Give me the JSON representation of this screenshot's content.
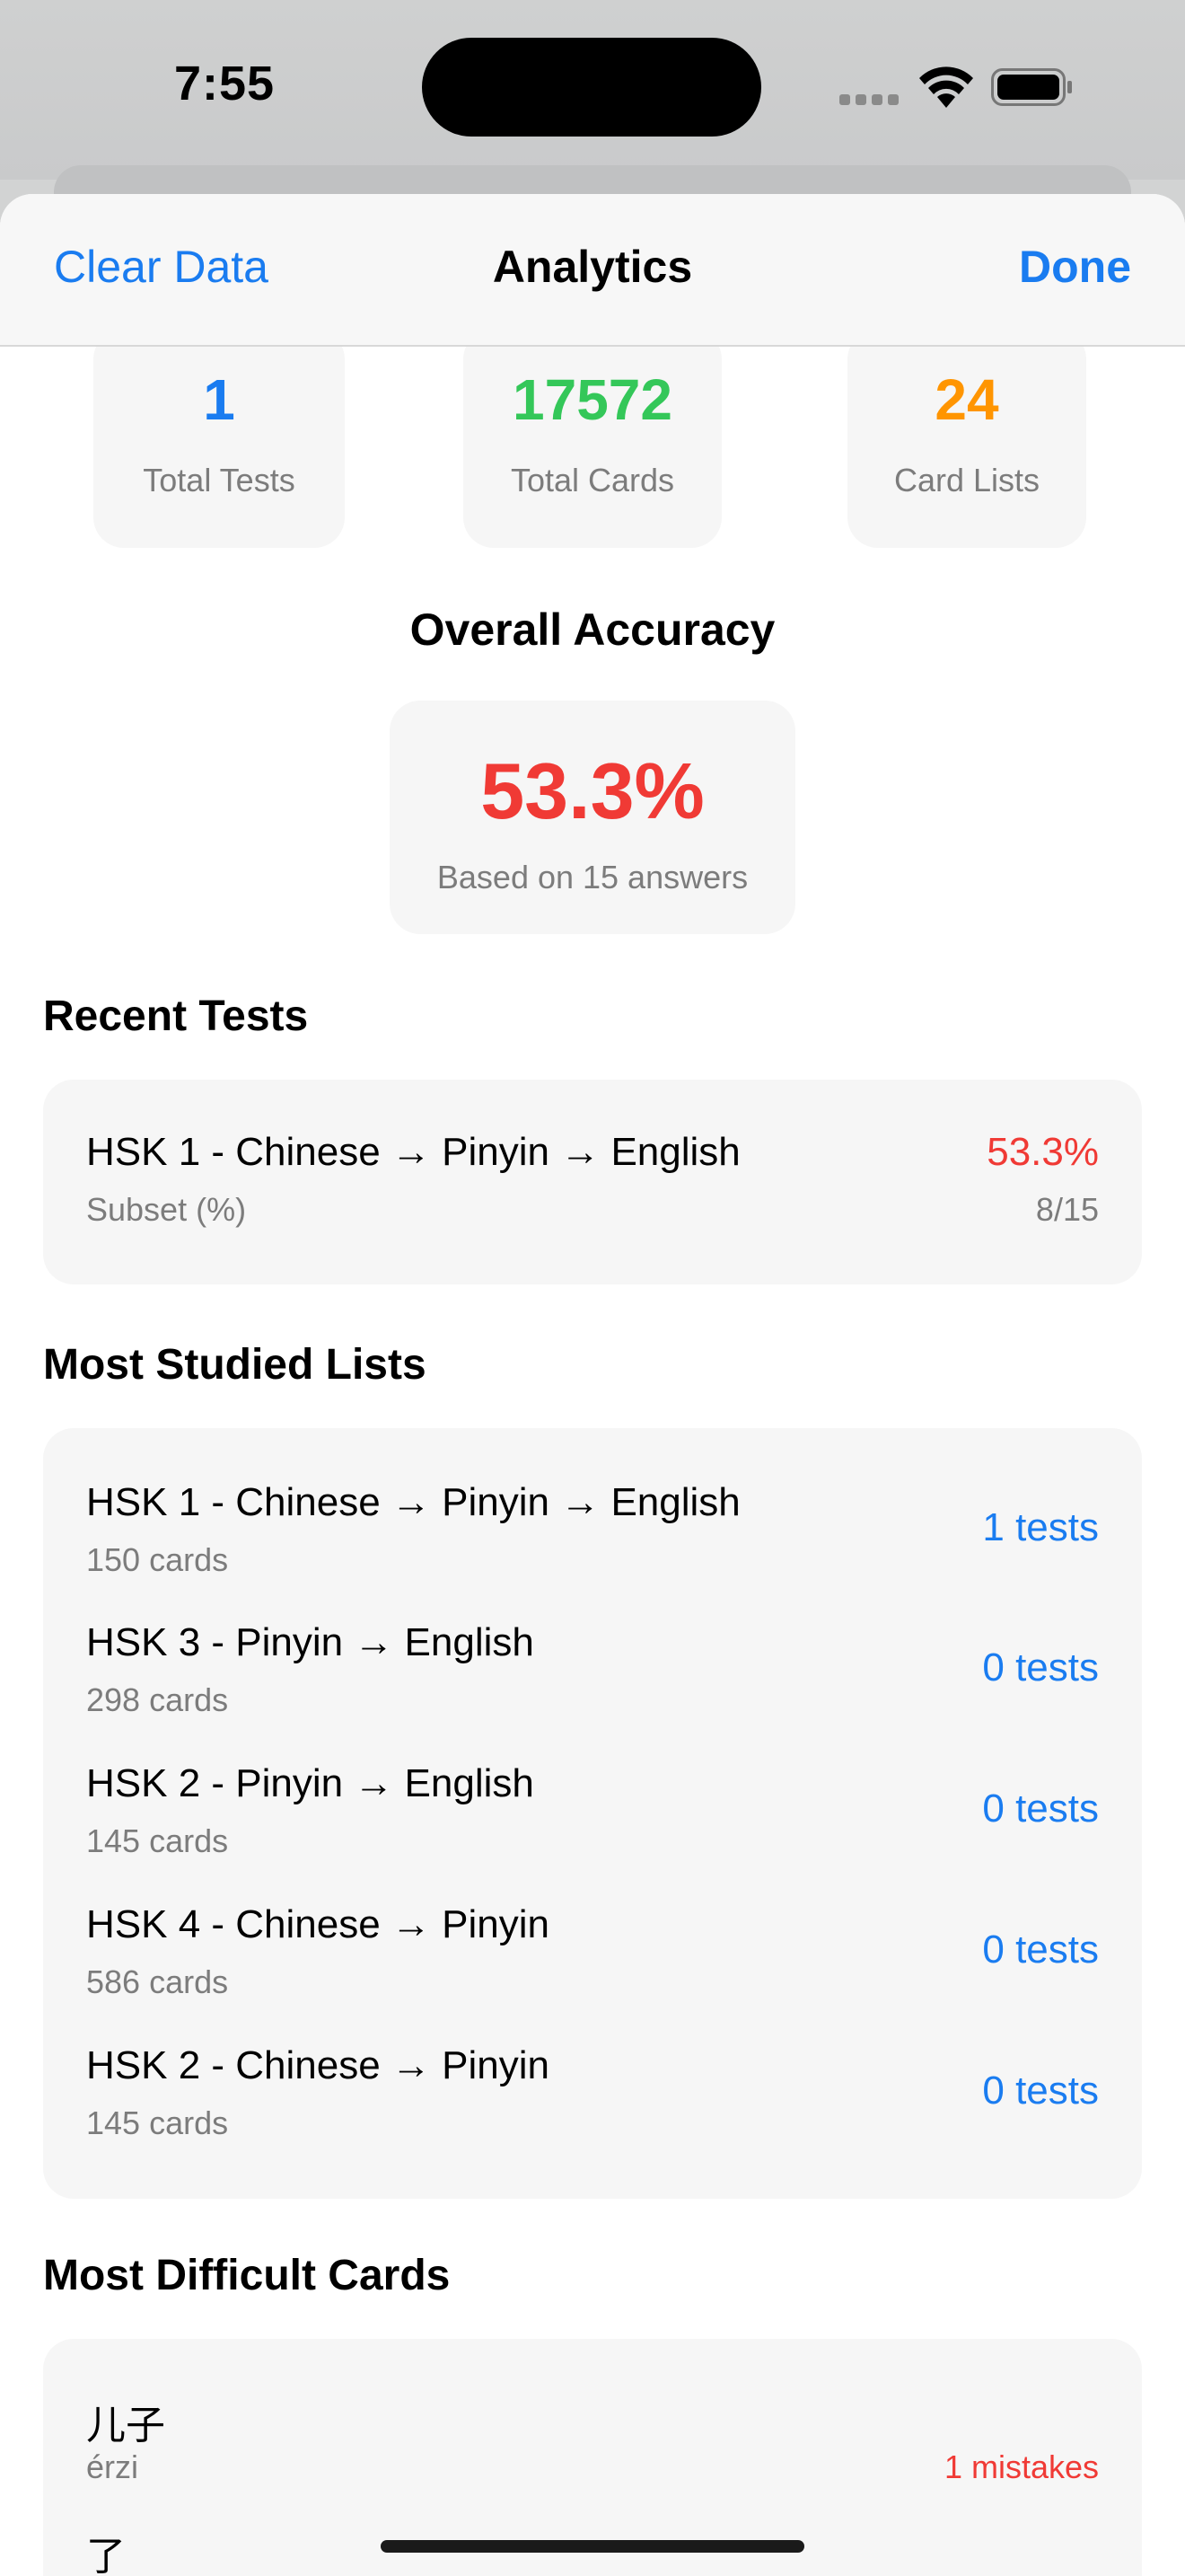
{
  "status": {
    "time": "7:55"
  },
  "nav": {
    "left_label": "Clear Data",
    "title": "Analytics",
    "right_label": "Done"
  },
  "colors": {
    "accent": "#1a7cf0",
    "green": "#34c759",
    "orange": "#ff9500",
    "red": "#f03a35"
  },
  "stats": [
    {
      "value": "1",
      "label": "Total Tests",
      "color": "#1a7cf0"
    },
    {
      "value": "17572",
      "label": "Total Cards",
      "color": "#34c759"
    },
    {
      "value": "24",
      "label": "Card Lists",
      "color": "#ff9500"
    }
  ],
  "accuracy": {
    "heading": "Overall Accuracy",
    "value": "53.3%",
    "caption": "Based on 15 answers"
  },
  "recent_tests": {
    "heading": "Recent Tests",
    "items": [
      {
        "title": "HSK 1 - Chinese → Pinyin → English",
        "subtitle": "Subset (%)",
        "score": "53.3%",
        "fraction": "8/15"
      }
    ]
  },
  "most_studied": {
    "heading": "Most Studied Lists",
    "items": [
      {
        "title": "HSK 1 - Chinese → Pinyin → English",
        "subtitle": "150 cards",
        "tests": "1 tests"
      },
      {
        "title": "HSK 3 - Pinyin → English",
        "subtitle": "298 cards",
        "tests": "0 tests"
      },
      {
        "title": "HSK 2 - Pinyin → English",
        "subtitle": "145 cards",
        "tests": "0 tests"
      },
      {
        "title": "HSK 4 - Chinese → Pinyin",
        "subtitle": "586 cards",
        "tests": "0 tests"
      },
      {
        "title": "HSK 2 - Chinese → Pinyin",
        "subtitle": "145 cards",
        "tests": "0 tests"
      }
    ]
  },
  "difficult": {
    "heading": "Most Difficult Cards",
    "items": [
      {
        "word": "儿子",
        "pinyin": "érzi",
        "mistakes": "1 mistakes"
      },
      {
        "word": "了",
        "pinyin": "",
        "mistakes": ""
      }
    ]
  }
}
